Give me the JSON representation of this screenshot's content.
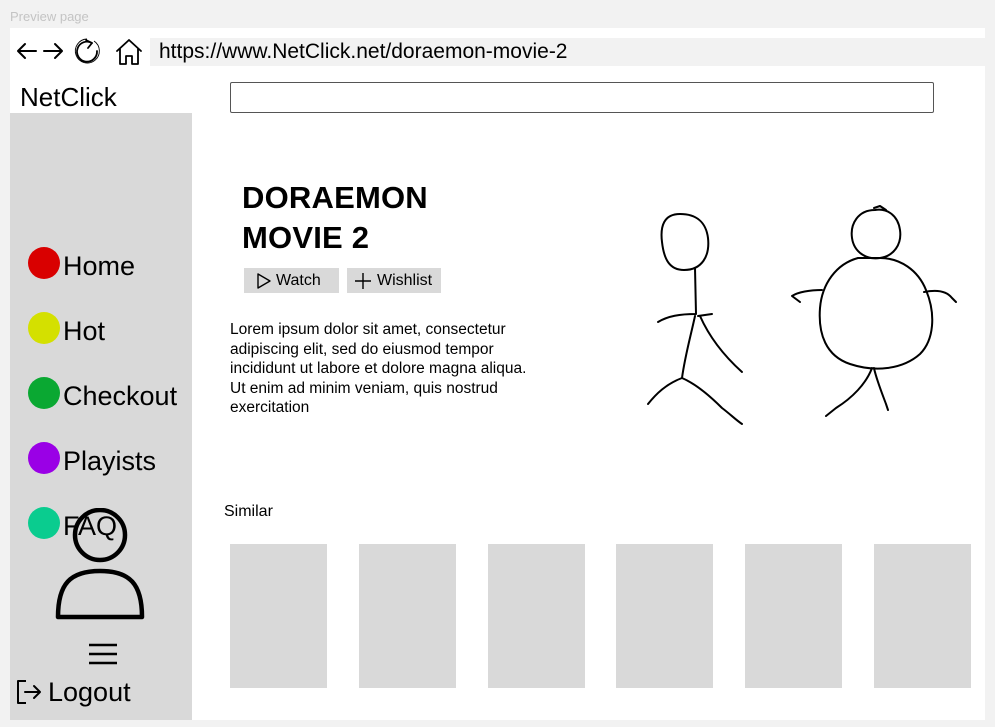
{
  "preview_label": "Preview page",
  "browser": {
    "url": "https://www.NetClick.net/doraemon-movie-2",
    "icons": [
      "back-arrow-icon",
      "forward-arrow-icon",
      "refresh-icon",
      "home-icon"
    ]
  },
  "app": {
    "brand": "NetClick",
    "search": {
      "value": "",
      "placeholder": ""
    }
  },
  "sidebar": {
    "items": [
      {
        "label": "Home",
        "color": "#d90000"
      },
      {
        "label": "Hot",
        "color": "#d4e000"
      },
      {
        "label": "Checkout",
        "color": "#0aa832"
      },
      {
        "label": "Playists",
        "color": "#9a00e6"
      },
      {
        "label": "FAQ",
        "color": "#0acc8f"
      }
    ],
    "avatar_icon": "user-icon",
    "menu_icon": "hamburger-menu-icon",
    "logout": {
      "label": "Logout",
      "icon": "logout-icon"
    }
  },
  "movie": {
    "title_line1": "DORAEMON",
    "title_line2": "MOVIE 2",
    "watch_label": "Watch",
    "wishlist_label": "Wishlist",
    "description": "Lorem ipsum dolor sit amet, consectetur adipiscing elit, sed do eiusmod tempor incididunt ut labore et dolore magna aliqua. Ut enim ad minim veniam, quis nostrud exercitation"
  },
  "similar": {
    "label": "Similar",
    "count": 6
  }
}
